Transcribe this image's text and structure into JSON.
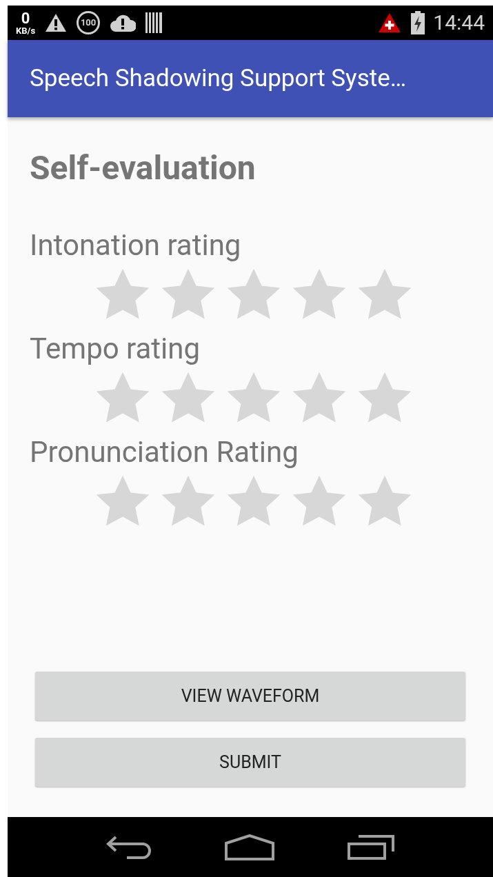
{
  "status_bar": {
    "speed_value": "0",
    "speed_unit": "KB/s",
    "badge": "100",
    "time": "14:44"
  },
  "app_bar": {
    "title": "Speech Shadowing Support Syste…"
  },
  "heading": "Self-evaluation",
  "ratings": [
    {
      "label": "Intonation rating",
      "stars": 0
    },
    {
      "label": "Tempo rating",
      "stars": 0
    },
    {
      "label": "Pronunciation Rating",
      "stars": 0
    }
  ],
  "buttons": [
    "VIEW WAVEFORM",
    "SUBMIT"
  ]
}
